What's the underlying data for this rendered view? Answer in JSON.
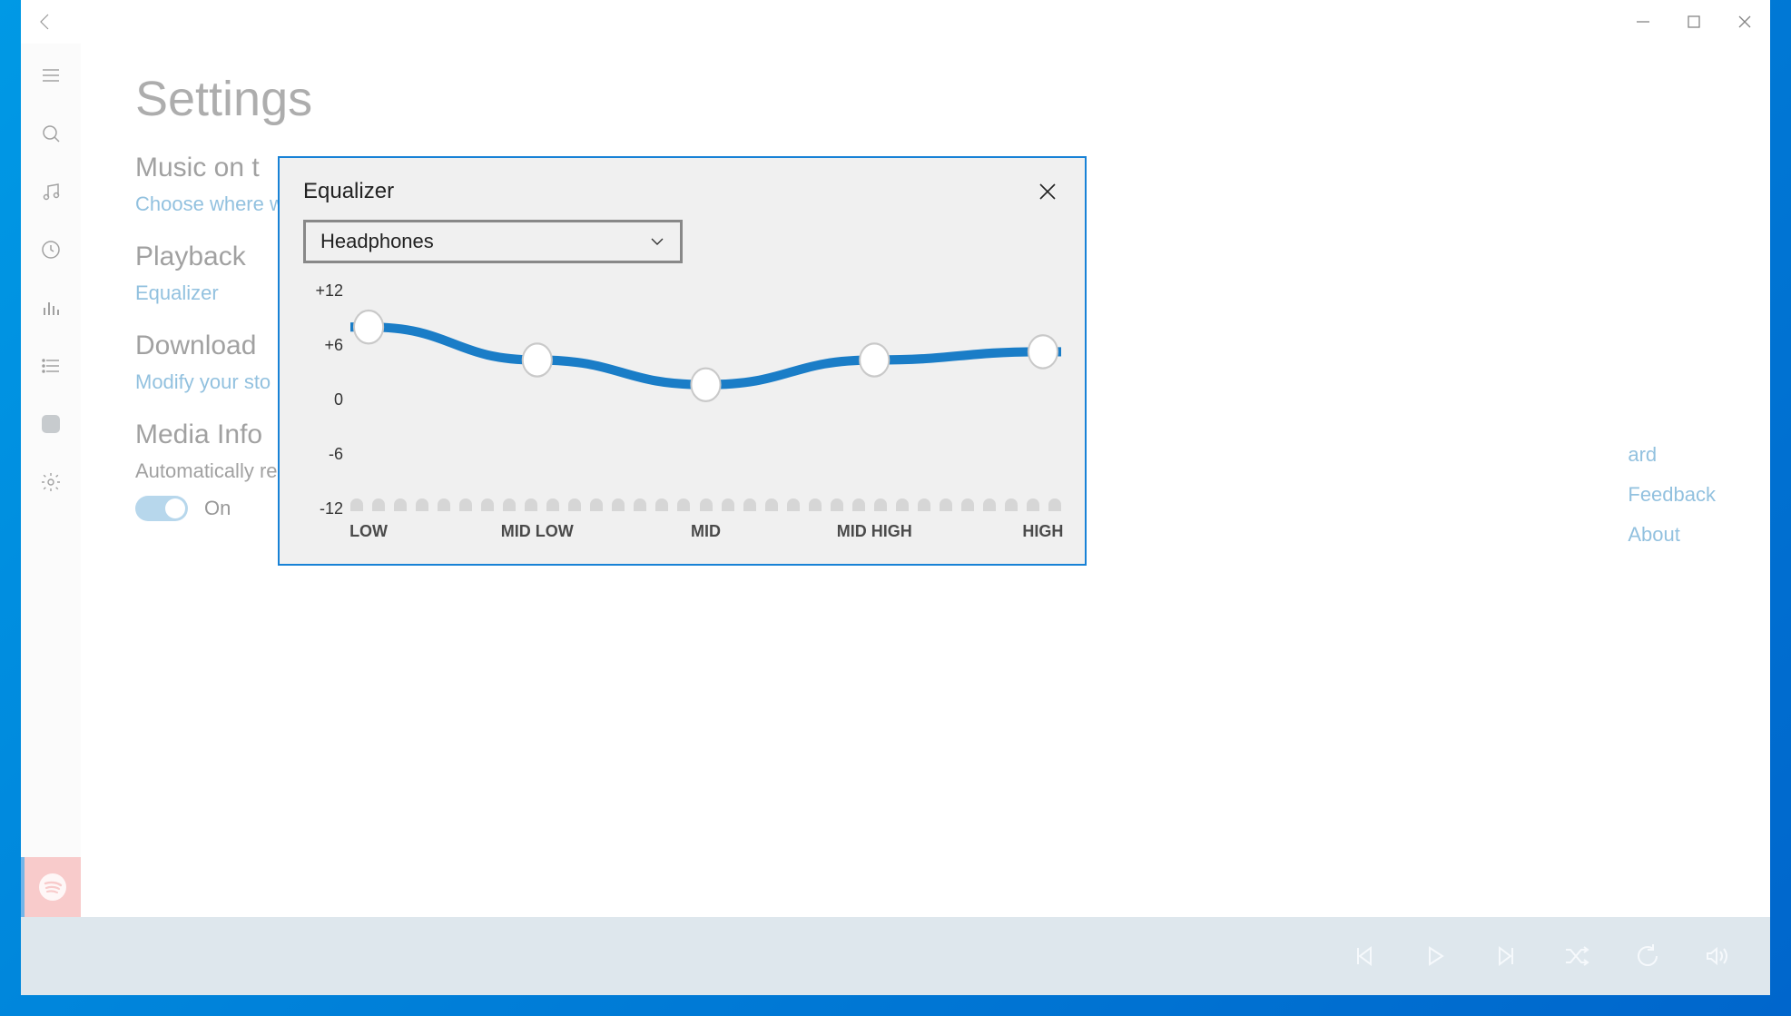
{
  "window_controls": {
    "minimize": "minimize",
    "maximize": "maximize",
    "close": "close"
  },
  "sidebar": {
    "items": [
      {
        "icon": "hamburger"
      },
      {
        "icon": "search"
      },
      {
        "icon": "music-note"
      },
      {
        "icon": "recent"
      },
      {
        "icon": "now-playing-bars"
      },
      {
        "icon": "playlists"
      },
      {
        "icon": "apps"
      },
      {
        "icon": "settings"
      }
    ]
  },
  "page": {
    "title": "Settings",
    "sections": {
      "music": {
        "title": "Music on t",
        "link": "Choose where w"
      },
      "playback": {
        "title": "Playback",
        "link": "Equalizer"
      },
      "downloads": {
        "title": "Download",
        "link": "Modify your sto"
      },
      "media_info": {
        "title": "Media Info",
        "sub": "Automatically re",
        "toggle_label": "On"
      }
    },
    "right_links": {
      "ard": "ard",
      "feedback": "Feedback",
      "about": "About"
    }
  },
  "modal": {
    "title": "Equalizer",
    "preset_selected": "Headphones"
  },
  "chart_data": {
    "type": "line",
    "categories": [
      "LOW",
      "MID LOW",
      "MID",
      "MID HIGH",
      "HIGH"
    ],
    "values": [
      7,
      3,
      0,
      3,
      4
    ],
    "ylabel": "",
    "xlabel": "",
    "ylim": [
      -12,
      12
    ],
    "yticks_labels": [
      "+12",
      "+6",
      "0",
      "-6",
      "-12"
    ],
    "yticks_values": [
      12,
      6,
      0,
      -6,
      -12
    ]
  },
  "player": {
    "controls": [
      "previous",
      "play",
      "next",
      "shuffle",
      "repeat",
      "volume"
    ]
  }
}
